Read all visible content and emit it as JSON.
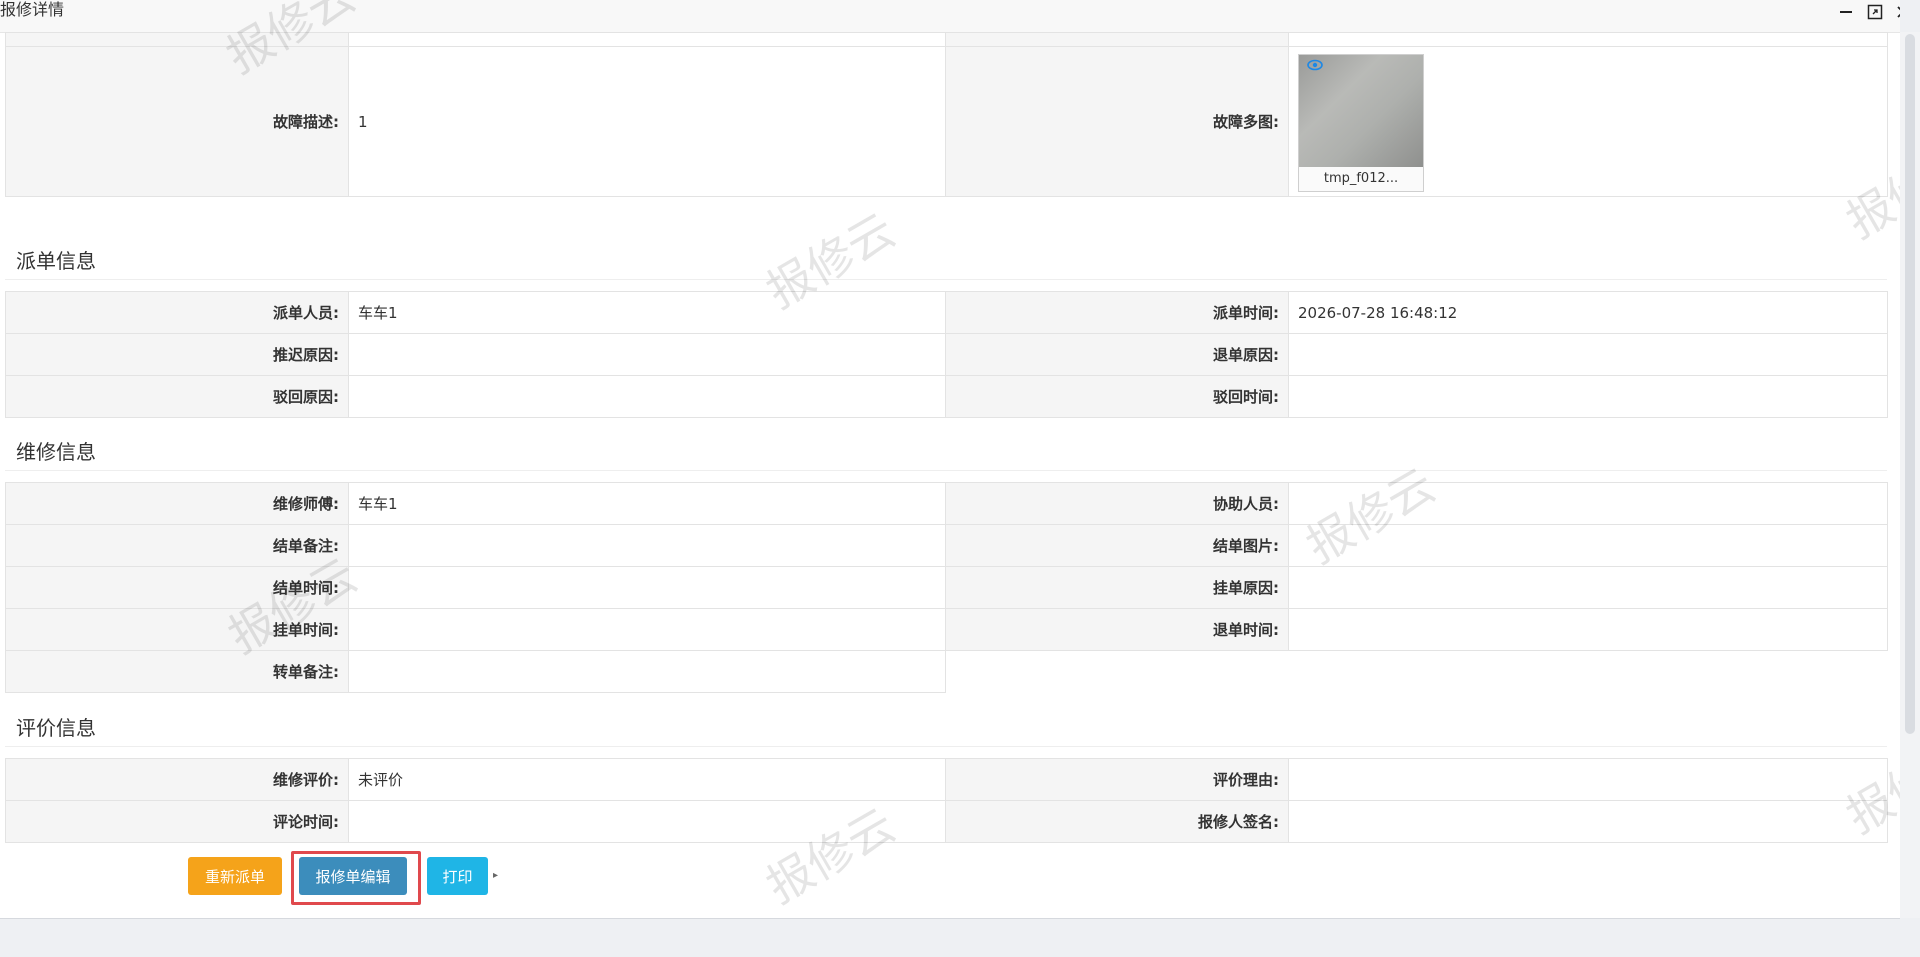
{
  "window": {
    "title": "报修详情",
    "minimize_icon": "minimize-icon",
    "maximize_icon": "maximize-icon",
    "close_icon": "close-icon"
  },
  "fault": {
    "description_label": "故障描述:",
    "description_value": "1",
    "images_label": "故障多图:",
    "image_name": "tmp_f012..."
  },
  "dispatch": {
    "section_title": "派单信息",
    "rows": [
      {
        "l1": "派单人员:",
        "v1": "车车1",
        "l2": "派单时间:",
        "v2": "2026-07-28 16:48:12"
      },
      {
        "l1": "推迟原因:",
        "v1": "",
        "l2": "退单原因:",
        "v2": ""
      },
      {
        "l1": "驳回原因:",
        "v1": "",
        "l2": "驳回时间:",
        "v2": ""
      }
    ]
  },
  "repair": {
    "section_title": "维修信息",
    "rows": [
      {
        "l1": "维修师傅:",
        "v1": "车车1",
        "l2": "协助人员:",
        "v2": ""
      },
      {
        "l1": "结单备注:",
        "v1": "",
        "l2": "结单图片:",
        "v2": ""
      },
      {
        "l1": "结单时间:",
        "v1": "",
        "l2": "挂单原因:",
        "v2": ""
      },
      {
        "l1": "挂单时间:",
        "v1": "",
        "l2": "退单时间:",
        "v2": ""
      },
      {
        "l1": "转单备注:",
        "v1": ""
      }
    ]
  },
  "evaluation": {
    "section_title": "评价信息",
    "rows": [
      {
        "l1": "维修评价:",
        "v1": "未评价",
        "l2": "评价理由:",
        "v2": ""
      },
      {
        "l1": "评论时间:",
        "v1": "",
        "l2": "报修人签名:",
        "v2": ""
      }
    ]
  },
  "actions": {
    "redispatch": "重新派单",
    "edit": "报修单编辑",
    "print": "打印"
  },
  "watermark_text": "报修云",
  "colors": {
    "redispatch": "#f5a31a",
    "edit": "#3c8dbc",
    "print": "#1fb5e6",
    "highlight": "#e0494d"
  }
}
